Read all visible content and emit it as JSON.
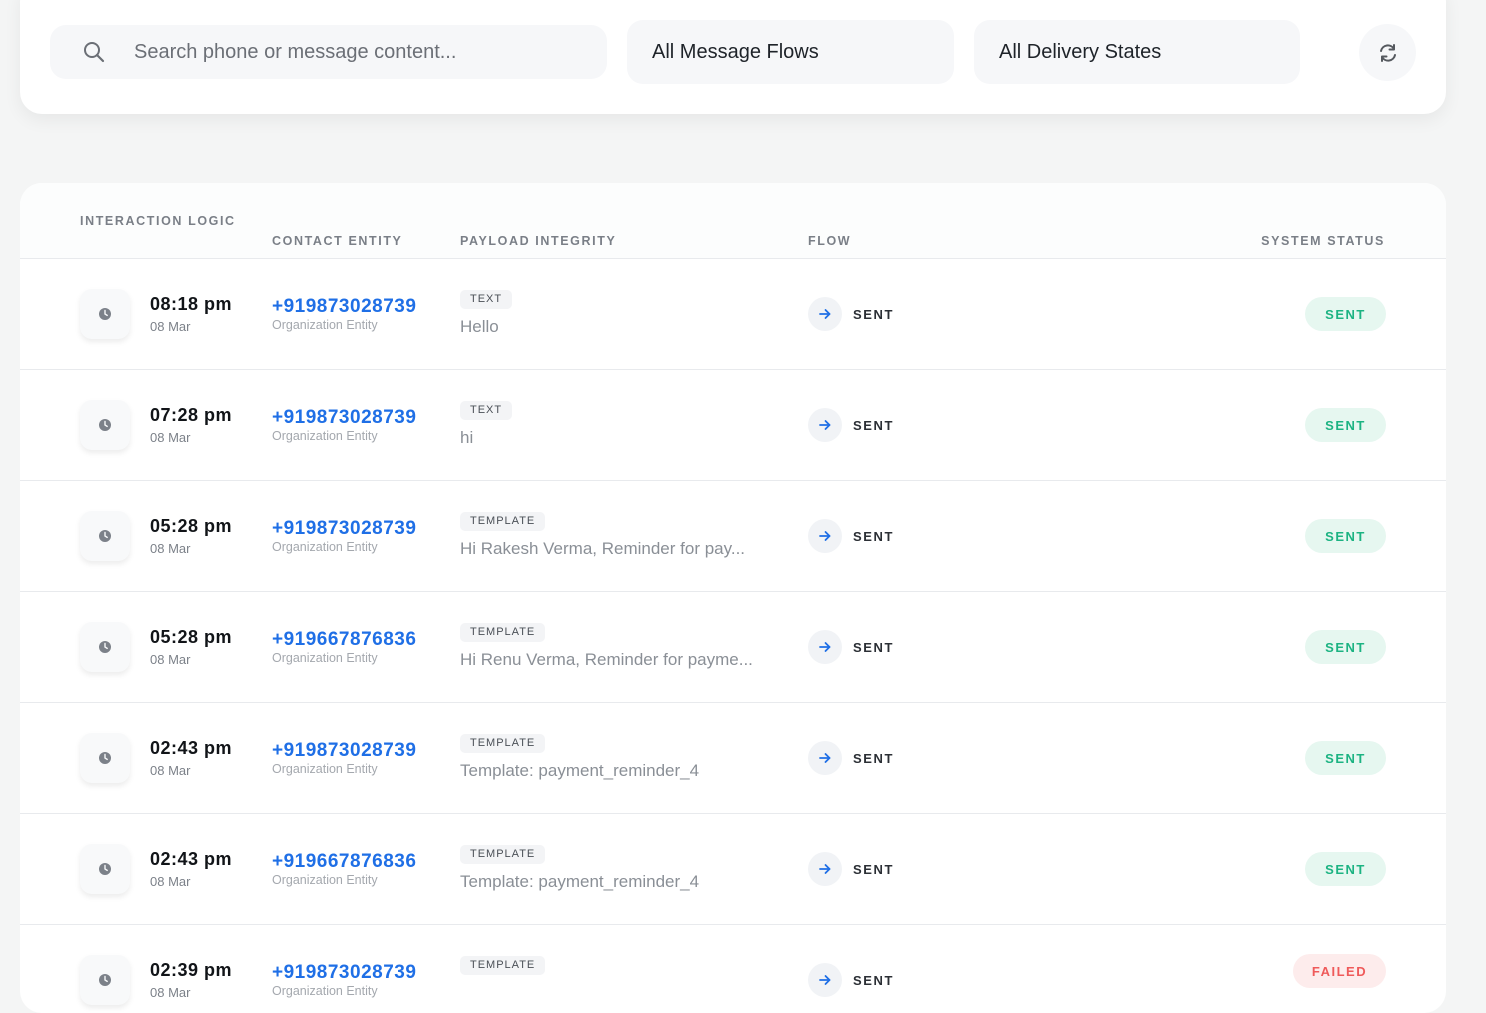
{
  "filters": {
    "search_placeholder": "Search phone or message content...",
    "flow_select": "All Message Flows",
    "state_select": "All Delivery States",
    "refresh_icon": "refresh-icon"
  },
  "table": {
    "headers": {
      "logic": "INTERACTION LOGIC",
      "contact": "CONTACT ENTITY",
      "payload": "PAYLOAD INTEGRITY",
      "flow": "FLOW",
      "status": "SYSTEM STATUS"
    },
    "rows": [
      {
        "time": "08:18 pm",
        "date": "08 Mar",
        "phone": "+919873028739",
        "entity": "Organization Entity",
        "kind": "TEXT",
        "content": "Hello",
        "flow": "SENT",
        "status": "SENT"
      },
      {
        "time": "07:28 pm",
        "date": "08 Mar",
        "phone": "+919873028739",
        "entity": "Organization Entity",
        "kind": "TEXT",
        "content": "hi",
        "flow": "SENT",
        "status": "SENT"
      },
      {
        "time": "05:28 pm",
        "date": "08 Mar",
        "phone": "+919873028739",
        "entity": "Organization Entity",
        "kind": "TEMPLATE",
        "content": "Hi Rakesh Verma, Reminder for pay...",
        "flow": "SENT",
        "status": "SENT"
      },
      {
        "time": "05:28 pm",
        "date": "08 Mar",
        "phone": "+919667876836",
        "entity": "Organization Entity",
        "kind": "TEMPLATE",
        "content": "Hi Renu Verma, Reminder for payme...",
        "flow": "SENT",
        "status": "SENT"
      },
      {
        "time": "02:43 pm",
        "date": "08 Mar",
        "phone": "+919873028739",
        "entity": "Organization Entity",
        "kind": "TEMPLATE",
        "content": "Template: payment_reminder_4",
        "flow": "SENT",
        "status": "SENT"
      },
      {
        "time": "02:43 pm",
        "date": "08 Mar",
        "phone": "+919667876836",
        "entity": "Organization Entity",
        "kind": "TEMPLATE",
        "content": "Template: payment_reminder_4",
        "flow": "SENT",
        "status": "SENT"
      },
      {
        "time": "02:39 pm",
        "date": "08 Mar",
        "phone": "+919873028739",
        "entity": "Organization Entity",
        "kind": "TEMPLATE",
        "content": "",
        "flow": "SENT",
        "status": "FAILED"
      }
    ]
  },
  "colors": {
    "accent_blue": "#1f6fe6",
    "sent_green": "#1cb382",
    "failed_red": "#ef5a5a"
  }
}
